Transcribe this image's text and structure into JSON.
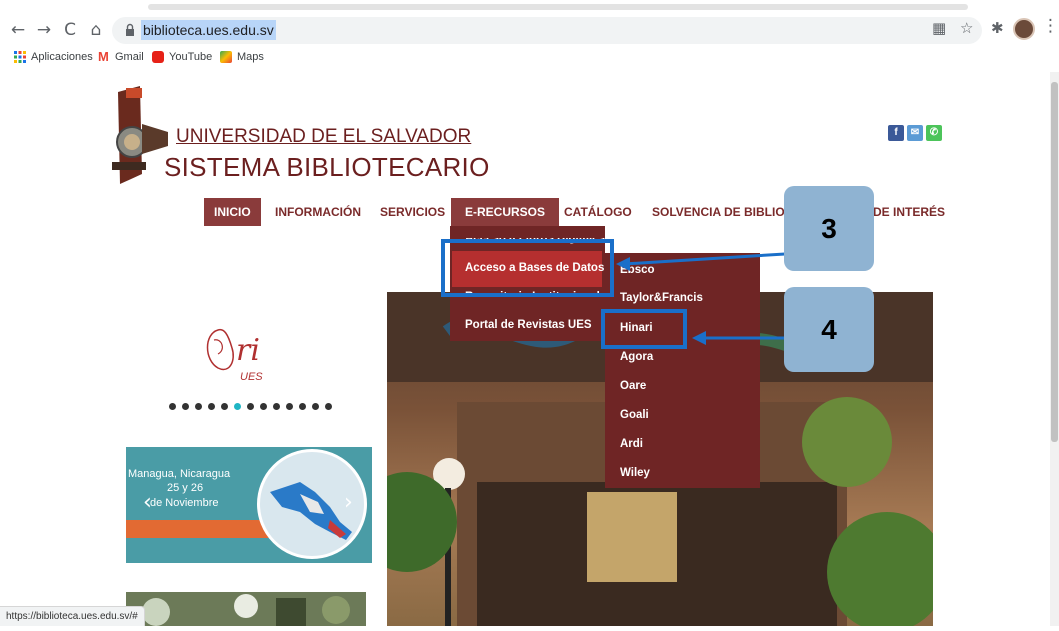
{
  "browser": {
    "url": "biblioteca.ues.edu.sv",
    "bookmarks": [
      "Aplicaciones",
      "Gmail",
      "YouTube",
      "Maps"
    ],
    "status_url": "https://biblioteca.ues.edu.sv/#"
  },
  "header": {
    "university": "UNIVERSIDAD DE EL SALVADOR",
    "system": "SISTEMA BIBLIOTECARIO"
  },
  "nav": {
    "items": [
      "INICIO",
      "INFORMACIÓN",
      "SERVICIOS",
      "E-RECURSOS",
      "CATÁLOGO",
      "SOLVENCIA DE BIBLIOTECA",
      "DE INTERÉS"
    ],
    "active": "INICIO",
    "open": "E-RECURSOS"
  },
  "erecursos_menu": {
    "items": [
      "Acceso a Libros Digitales",
      "Acceso a Bases de Datos",
      "Repositorio Institucional",
      "Portal de Revistas UES"
    ],
    "selected": "Acceso a Bases de Datos"
  },
  "bases_menu": {
    "items": [
      "Ebsco",
      "Taylor&Francis",
      "Hinari",
      "Agora",
      "Oare",
      "Goali",
      "Ardi",
      "Wiley"
    ],
    "highlighted": "Hinari"
  },
  "callouts": [
    "3",
    "4"
  ],
  "banner": {
    "line1": "Managua, Nicaragua",
    "line2": "25 y 26",
    "line3": "de Noviembre"
  },
  "ori_logo": "UES",
  "colors": {
    "brand_maroon": "#6f2525",
    "active_red": "#b52f2f",
    "callout_blue": "#8fb3d2",
    "highlight_border": "#1a6fc9"
  }
}
